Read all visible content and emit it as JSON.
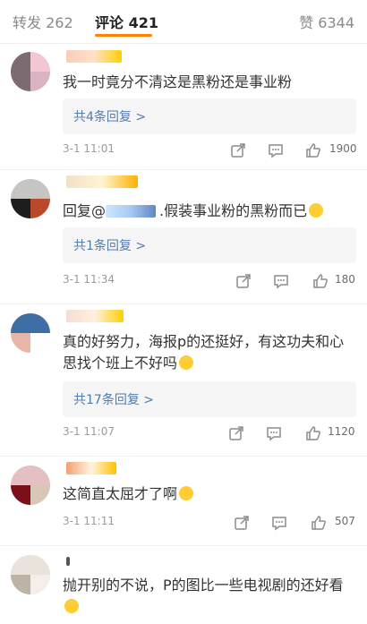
{
  "tabs": [
    {
      "label": "转发 262"
    },
    {
      "label": "评论 421"
    },
    {
      "label": "赞 6344"
    }
  ],
  "colors": {
    "accent": "#ff8200",
    "link": "#4e7db3",
    "time": "#9b9b9b"
  },
  "comments": [
    {
      "content": "我一时竟分不清这是黑粉还是事业粉",
      "replies_label": "共4条回复 >",
      "time": "3-1 11:01",
      "likes": "1900"
    },
    {
      "content_prefix": "回复@",
      "content_suffix": ".假装事业粉的黑粉而已",
      "emoji": "smile-emoji",
      "replies_label": "共1条回复 >",
      "time": "3-1 11:34",
      "likes": "180"
    },
    {
      "content": "真的好努力，海报p的还挺好，有这功夫和心思找个班上不好吗",
      "emoji": "laugh-emoji",
      "replies_label": "共17条回复 >",
      "time": "3-1 11:07",
      "likes": "1120"
    },
    {
      "content": "这简直太屈才了啊",
      "emoji": "laugh-emoji",
      "time": "3-1 11:11",
      "likes": "507"
    },
    {
      "content": "抛开别的不说，P的图比一些电视剧的还好看",
      "emoji": "smirk-emoji"
    }
  ],
  "icons": {
    "share": "share-icon",
    "comment": "comment-icon",
    "like": "thumbs-up-icon"
  }
}
